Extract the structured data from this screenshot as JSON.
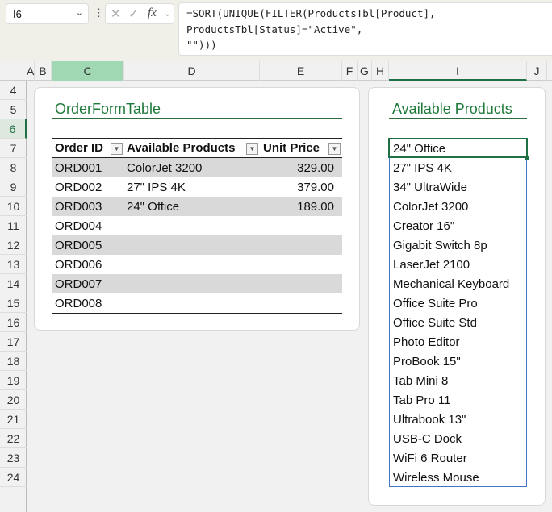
{
  "formula_bar": {
    "name_box": "I6",
    "formula": "=SORT(UNIQUE(FILTER(ProductsTbl[Product],\nProductsTbl[Status]=\"Active\",\n\"\")))"
  },
  "columns": [
    "A",
    "B",
    "C",
    "D",
    "E",
    "F",
    "G",
    "H",
    "I",
    "J"
  ],
  "rows": [
    "4",
    "5",
    "6",
    "7",
    "8",
    "9",
    "10",
    "11",
    "12",
    "13",
    "14",
    "15",
    "16",
    "17",
    "18",
    "19",
    "20",
    "21",
    "22",
    "23",
    "24"
  ],
  "order_card": {
    "title": "OrderFormTable",
    "headers": [
      "Order ID",
      "Available Products",
      "Unit Price"
    ],
    "rows": [
      [
        "ORD001",
        "ColorJet 3200",
        "329.00"
      ],
      [
        "ORD002",
        "27\" IPS 4K",
        "379.00"
      ],
      [
        "ORD003",
        "24\" Office",
        "189.00"
      ],
      [
        "ORD004",
        "",
        ""
      ],
      [
        "ORD005",
        "",
        ""
      ],
      [
        "ORD006",
        "",
        ""
      ],
      [
        "ORD007",
        "",
        ""
      ],
      [
        "ORD008",
        "",
        ""
      ]
    ]
  },
  "products_card": {
    "title": "Available Products",
    "items": [
      "24\" Office",
      "27\" IPS 4K",
      "34\" UltraWide",
      "ColorJet 3200",
      "Creator 16\"",
      "Gigabit Switch 8p",
      "LaserJet 2100",
      "Mechanical Keyboard",
      "Office Suite Pro",
      "Office Suite Std",
      "Photo Editor",
      "ProBook 15\"",
      "Tab Mini 8",
      "Tab Pro 11",
      "Ultrabook 13\"",
      "USB-C Dock",
      "WiFi 6 Router",
      "Wireless Mouse"
    ]
  },
  "colors": {
    "accent": "#1e7145",
    "title": "#1e7a3a",
    "list_border": "#4472c4",
    "band": "#d9d9d9"
  }
}
